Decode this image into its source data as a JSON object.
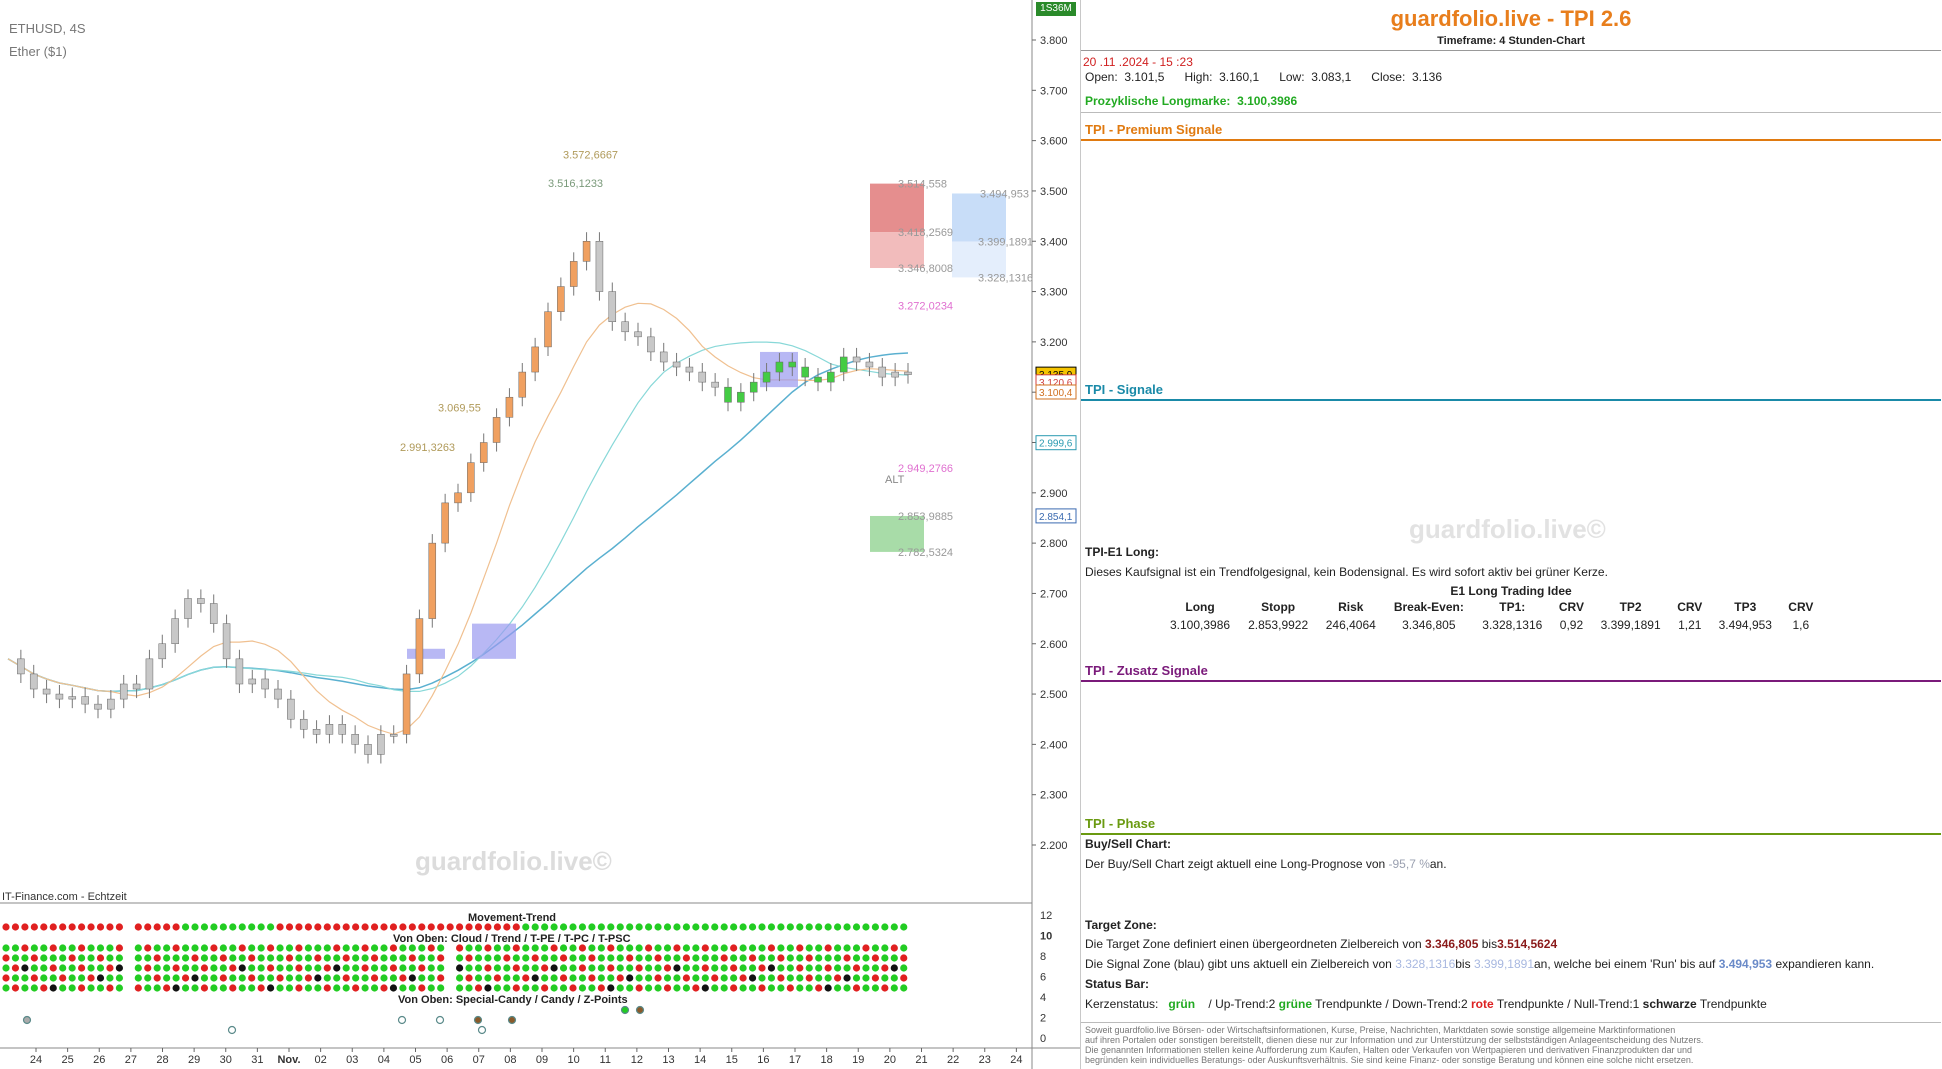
{
  "chart": {
    "symbol": "ETHUSD, 4S",
    "name": "Ether ($1)",
    "watermark": "guardfolio.live©",
    "source": "IT-Finance.com - Echtzeit",
    "badge": "1S36M",
    "alt_label": "ALT",
    "indicator_title": "Movement-Trend",
    "indicator_sub1": "Von Oben: Cloud / Trend / T-PE / T-PC / T-PSC",
    "indicator_sub2": "Von Oben: Special-Candy / Candy / Z-Points"
  },
  "chart_data": {
    "type": "line",
    "x_ticks": [
      "24",
      "25",
      "26",
      "27",
      "28",
      "29",
      "30",
      "31",
      "Nov.",
      "02",
      "03",
      "04",
      "05",
      "06",
      "07",
      "08",
      "09",
      "10",
      "11",
      "12",
      "13",
      "14",
      "15",
      "16",
      "17",
      "18",
      "19",
      "20",
      "21",
      "22",
      "23",
      "24"
    ],
    "y_ticks": [
      "3.800",
      "3.700",
      "3.600",
      "3.500",
      "3.400",
      "3.300",
      "3.200",
      "3.100",
      "3.000",
      "2.900",
      "2.800",
      "2.700",
      "2.600",
      "2.500",
      "2.400",
      "2.300",
      "2.200"
    ],
    "ylim": [
      2200,
      3800
    ],
    "price_series": [
      2570,
      2540,
      2510,
      2500,
      2490,
      2495,
      2480,
      2470,
      2490,
      2520,
      2510,
      2570,
      2600,
      2650,
      2690,
      2680,
      2640,
      2570,
      2520,
      2530,
      2510,
      2490,
      2450,
      2430,
      2420,
      2440,
      2420,
      2400,
      2380,
      2420,
      2420,
      2540,
      2650,
      2800,
      2880,
      2900,
      2960,
      3000,
      3050,
      3090,
      3140,
      3190,
      3260,
      3310,
      3360,
      3400,
      3300,
      3240,
      3220,
      3210,
      3180,
      3160,
      3150,
      3140,
      3120,
      3110,
      3080,
      3100,
      3120,
      3140,
      3160,
      3150,
      3130,
      3120,
      3140,
      3170,
      3160,
      3150,
      3130,
      3140,
      3135
    ],
    "level_labels": [
      {
        "label": "3.572,6667",
        "value": 3572.67,
        "color": "#b09a5a"
      },
      {
        "label": "3.516,1233",
        "value": 3516.12,
        "color": "#7a9a7a"
      },
      {
        "label": "3.514,558",
        "value": 3514.56,
        "color": "#999999"
      },
      {
        "label": "3.494,953",
        "value": 3494.95,
        "color": "#999999"
      },
      {
        "label": "3.418,2569",
        "value": 3418.26,
        "color": "#999999"
      },
      {
        "label": "3.399,1891",
        "value": 3399.19,
        "color": "#999999"
      },
      {
        "label": "3.346,8008",
        "value": 3346.8,
        "color": "#999999"
      },
      {
        "label": "3.328,1316",
        "value": 3328.13,
        "color": "#999999"
      },
      {
        "label": "3.272,0234",
        "value": 3272.02,
        "color": "#e070d0"
      },
      {
        "label": "3.069,55",
        "value": 3069.55,
        "color": "#b09a5a"
      },
      {
        "label": "2.991,3263",
        "value": 2991.33,
        "color": "#b09a5a"
      },
      {
        "label": "2.949,2766",
        "value": 2949.28,
        "color": "#e070d0"
      },
      {
        "label": "2.853,9885",
        "value": 2853.99,
        "color": "#999999"
      },
      {
        "label": "2.782,5324",
        "value": 2782.53,
        "color": "#999999"
      }
    ],
    "price_tags": [
      {
        "label": "3.135,9",
        "value": 3135.9,
        "bg": "#f5c400",
        "fg": "#000000"
      },
      {
        "label": "3.120,6",
        "value": 3120.6,
        "bg": "#ffffff",
        "fg": "#d04040"
      },
      {
        "label": "3.100,4",
        "value": 3100.4,
        "bg": "#ffffff",
        "fg": "#d07020"
      },
      {
        "label": "2.999,6",
        "value": 2999.6,
        "bg": "#ffffff",
        "fg": "#2a9ab0"
      },
      {
        "label": "2.854,1",
        "value": 2854.1,
        "bg": "#ffffff",
        "fg": "#3a6ab0"
      }
    ],
    "indicator_ticks": [
      "12",
      "10",
      "8",
      "6",
      "4",
      "2",
      "0"
    ]
  },
  "panel": {
    "title": "guardfolio.live - TPI 2.6",
    "timeframe": "Timeframe: 4 Stunden-Chart",
    "datetime": "20 .11 .2024  - 15 :23",
    "ohlc": {
      "open_label": "Open:",
      "open": "3.101,5",
      "high_label": "High:",
      "high": "3.160,1",
      "low_label": "Low:",
      "low": "3.083,1",
      "close_label": "Close:",
      "close": "3.136"
    },
    "longmark_label": "Prozyklische Longmarke:",
    "longmark_value": "3.100,3986",
    "premium_title": "TPI - Premium Signale",
    "signals_title": "TPI - Signale",
    "watermark": "guardfolio.live©",
    "e1_title": "TPI-E1 Long:",
    "e1_text": "Dieses Kaufsignal ist ein Trendfolgesignal, kein Bodensignal. Es wird sofort aktiv bei grüner Kerze.",
    "idea_title": "E1 Long Trading Idee",
    "table_headers": [
      "Long",
      "Stopp",
      "Risk",
      "Break-Even:",
      "TP1:",
      "CRV",
      "TP2",
      "CRV",
      "TP3",
      "CRV"
    ],
    "table_values": [
      "3.100,3986",
      "2.853,9922",
      "246,4064",
      "3.346,805",
      "3.328,1316",
      "0,92",
      "3.399,1891",
      "1,21",
      "3.494,953",
      "1,6"
    ],
    "zusatz_title": "TPI - Zusatz Signale",
    "phase_title": "TPI - Phase",
    "buysell_title": "Buy/Sell Chart:",
    "buysell_pre": "Der Buy/Sell Chart zeigt aktuell eine Long-Prognose von",
    "buysell_value": "-95,7 %",
    "buysell_post": "an.",
    "target_title": "Target Zone:",
    "target_pre": "Die Target Zone definiert einen übergeordneten Zielbereich von",
    "target_v1": "3.346,805",
    "target_mid": "bis",
    "target_v2": "3.514,5624",
    "signalzone_pre": "Die Signal Zone (blau) gibt uns aktuell ein Zielbereich von",
    "signalzone_v1": "3.328,1316",
    "signalzone_mid": "bis",
    "signalzone_v2": "3.399,1891",
    "signalzone_post": "an, welche bei einem 'Run' bis auf",
    "signalzone_v3": "3.494,953",
    "signalzone_end": "expandieren kann.",
    "status_title": "Status Bar:",
    "status_a": "Kerzenstatus:",
    "status_b": "grün",
    "status_c": "/ Up-Trend:2",
    "status_d": "grüne",
    "status_e": "Trendpunkte  / Down-Trend:2",
    "status_f": "rote",
    "status_g": "Trendpunkte / Null-Trend:1",
    "status_h": "schwarze",
    "status_i": "Trendpunkte",
    "disclaimer": [
      "Soweit guardfolio.live Börsen- oder Wirtschaftsinformationen, Kurse, Preise, Nachrichten, Marktdaten sowie sonstige allgemeine Marktinformationen",
      "auf ihren Portalen oder sonstigen bereitstellt, dienen diese nur zur Information und zur Unterstützung der selbstständigen Anlageentscheidung des Nutzers.",
      "Die genannten Informationen stellen keine Aufforderung zum Kaufen, Halten oder Verkaufen von Wertpapieren und derivativen Finanzprodukten dar und",
      "begründen kein individuelles Beratungs- oder Auskunftsverhältnis. Sie sind keine Finanz- oder sonstige Beratung und können eine solche nicht ersetzen."
    ]
  },
  "colors": {
    "orange": "#e87e1c",
    "premium": "#e07a10",
    "signals": "#1a8aa8",
    "zusatz": "#7a1a7a",
    "phase": "#6a9a10",
    "green": "#22aa22",
    "red": "#dd2222"
  }
}
